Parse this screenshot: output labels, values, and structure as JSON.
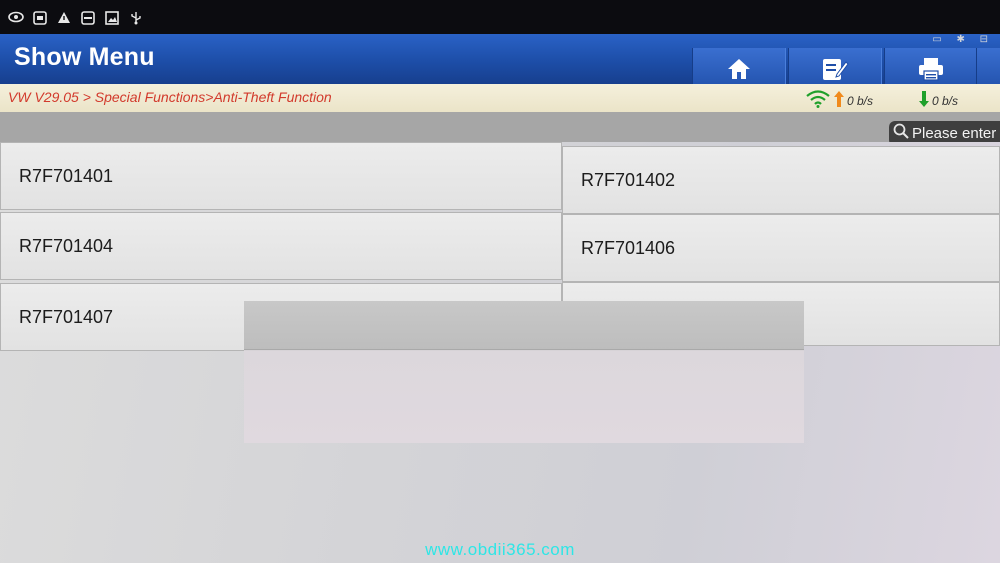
{
  "statusbar": {
    "icons": [
      "eye-icon",
      "screen-cast-icon",
      "warning-icon",
      "cast-icon",
      "image-icon",
      "usb-icon"
    ]
  },
  "header": {
    "title": "Show Menu",
    "buttons": [
      {
        "name": "home-button",
        "icon": "home-icon"
      },
      {
        "name": "edit-button",
        "icon": "edit-icon"
      },
      {
        "name": "print-button",
        "icon": "printer-icon"
      }
    ]
  },
  "breadcrumb": "VW V29.05 > Special Functions>Anti-Theft Function",
  "network": {
    "upload": "0 b/s",
    "download": "0 b/s"
  },
  "search": {
    "placeholder": "Please enter"
  },
  "items": [
    {
      "label": "R7F701401"
    },
    {
      "label": "R7F701402"
    },
    {
      "label": "R7F701404"
    },
    {
      "label": "R7F701406"
    },
    {
      "label": "R7F701407"
    }
  ],
  "watermark": "www.obdii365.com",
  "colors": {
    "header_blue": "#1d4ea8",
    "breadcrumb_red": "#d23a2c",
    "upload_orange": "#f08a1c",
    "download_green": "#1fa02a",
    "watermark_cyan": "#2ee6e6"
  }
}
